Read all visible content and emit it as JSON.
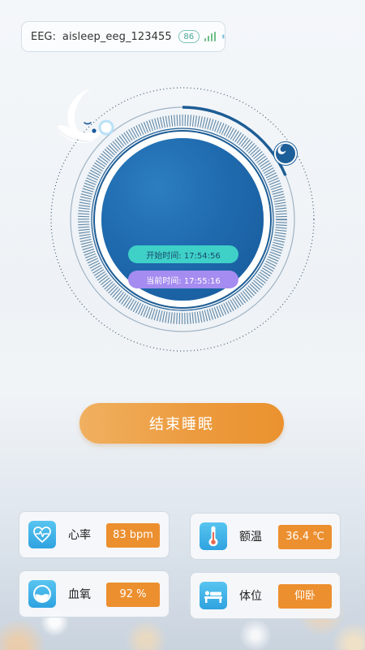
{
  "device": {
    "eeg_label": "EEG:",
    "device_name": "aisleep_eeg_123455",
    "battery": "86",
    "signal_icon": "signal-bars-icon",
    "bluetooth_icon": "bluetooth-icon"
  },
  "session": {
    "start_time_text": "开始时间: 17:54:56",
    "current_time_text": "当前时间: 17:55:16"
  },
  "actions": {
    "end_sleep_label": "结束睡眠"
  },
  "metrics": {
    "heart_rate": {
      "label": "心率",
      "value": "83 bpm",
      "icon": "heart-pulse-icon"
    },
    "forehead_temp": {
      "label": "额温",
      "value": "36.4 ℃",
      "icon": "thermometer-icon"
    },
    "blood_oxygen": {
      "label": "血氧",
      "value": "92 %",
      "icon": "oxygen-gauge-icon"
    },
    "body_position": {
      "label": "体位",
      "value": "仰卧",
      "icon": "lying-person-icon"
    }
  },
  "colors": {
    "accent_orange": "#ec8f2f",
    "dial_blue": "#1f6aae",
    "start_pill": "#3fd0c8",
    "current_pill": "#a58cf0",
    "icon_blue": "#3aaee6"
  }
}
